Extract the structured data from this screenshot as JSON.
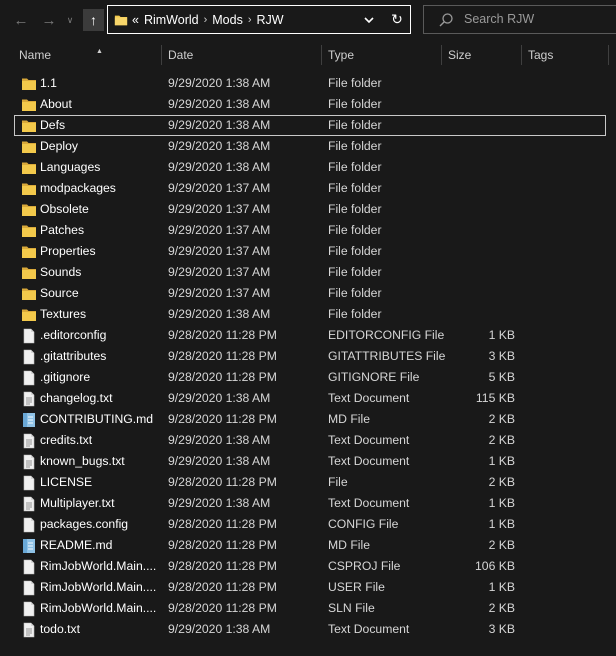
{
  "toolbar": {
    "back_glyph": "←",
    "forward_glyph": "→",
    "recent_glyph": "∨",
    "up_glyph": "↑",
    "address": {
      "overflow": "«",
      "crumbs": [
        "RimWorld",
        "Mods",
        "RJW"
      ],
      "separator": "›",
      "dropdown_glyph": "⌄",
      "refresh_glyph": "↻"
    },
    "search_placeholder": "Search RJW"
  },
  "columns": [
    "Name",
    "Date",
    "Type",
    "Size",
    "Tags"
  ],
  "colors": {
    "background": "#191919",
    "folder": "#f3c94b",
    "folder_dark": "#d9a93a",
    "file": "#f0f0f0",
    "md_file": "#8fc2e6",
    "selected_border": "#c8c8c8"
  },
  "files": [
    {
      "name": "1.1",
      "date": "9/29/2020 1:38 AM",
      "type": "File folder",
      "size": "",
      "icon": "folder-icon"
    },
    {
      "name": "About",
      "date": "9/29/2020 1:38 AM",
      "type": "File folder",
      "size": "",
      "icon": "folder-icon"
    },
    {
      "name": "Defs",
      "date": "9/29/2020 1:38 AM",
      "type": "File folder",
      "size": "",
      "icon": "folder-icon",
      "selected": true
    },
    {
      "name": "Deploy",
      "date": "9/29/2020 1:38 AM",
      "type": "File folder",
      "size": "",
      "icon": "folder-icon"
    },
    {
      "name": "Languages",
      "date": "9/29/2020 1:38 AM",
      "type": "File folder",
      "size": "",
      "icon": "folder-icon"
    },
    {
      "name": "modpackages",
      "date": "9/29/2020 1:37 AM",
      "type": "File folder",
      "size": "",
      "icon": "folder-icon"
    },
    {
      "name": "Obsolete",
      "date": "9/29/2020 1:37 AM",
      "type": "File folder",
      "size": "",
      "icon": "folder-icon"
    },
    {
      "name": "Patches",
      "date": "9/29/2020 1:37 AM",
      "type": "File folder",
      "size": "",
      "icon": "folder-icon"
    },
    {
      "name": "Properties",
      "date": "9/29/2020 1:37 AM",
      "type": "File folder",
      "size": "",
      "icon": "folder-icon"
    },
    {
      "name": "Sounds",
      "date": "9/29/2020 1:37 AM",
      "type": "File folder",
      "size": "",
      "icon": "folder-icon"
    },
    {
      "name": "Source",
      "date": "9/29/2020 1:37 AM",
      "type": "File folder",
      "size": "",
      "icon": "folder-icon"
    },
    {
      "name": "Textures",
      "date": "9/29/2020 1:38 AM",
      "type": "File folder",
      "size": "",
      "icon": "folder-icon"
    },
    {
      "name": ".editorconfig",
      "date": "9/28/2020 11:28 PM",
      "type": "EDITORCONFIG File",
      "size": "1 KB",
      "icon": "file-icon"
    },
    {
      "name": ".gitattributes",
      "date": "9/28/2020 11:28 PM",
      "type": "GITATTRIBUTES File",
      "size": "3 KB",
      "icon": "file-icon"
    },
    {
      "name": ".gitignore",
      "date": "9/28/2020 11:28 PM",
      "type": "GITIGNORE File",
      "size": "5 KB",
      "icon": "file-icon"
    },
    {
      "name": "changelog.txt",
      "date": "9/29/2020 1:38 AM",
      "type": "Text Document",
      "size": "115 KB",
      "icon": "text-file-icon"
    },
    {
      "name": "CONTRIBUTING.md",
      "date": "9/28/2020 11:28 PM",
      "type": "MD File",
      "size": "2 KB",
      "icon": "markdown-file-icon"
    },
    {
      "name": "credits.txt",
      "date": "9/29/2020 1:38 AM",
      "type": "Text Document",
      "size": "2 KB",
      "icon": "text-file-icon"
    },
    {
      "name": "known_bugs.txt",
      "date": "9/29/2020 1:38 AM",
      "type": "Text Document",
      "size": "1 KB",
      "icon": "text-file-icon"
    },
    {
      "name": "LICENSE",
      "date": "9/28/2020 11:28 PM",
      "type": "File",
      "size": "2 KB",
      "icon": "file-icon"
    },
    {
      "name": "Multiplayer.txt",
      "date": "9/29/2020 1:38 AM",
      "type": "Text Document",
      "size": "1 KB",
      "icon": "text-file-icon"
    },
    {
      "name": "packages.config",
      "date": "9/28/2020 11:28 PM",
      "type": "CONFIG File",
      "size": "1 KB",
      "icon": "file-icon"
    },
    {
      "name": "README.md",
      "date": "9/28/2020 11:28 PM",
      "type": "MD File",
      "size": "2 KB",
      "icon": "markdown-file-icon"
    },
    {
      "name": "RimJobWorld.Main....",
      "date": "9/28/2020 11:28 PM",
      "type": "CSPROJ File",
      "size": "106 KB",
      "icon": "file-icon"
    },
    {
      "name": "RimJobWorld.Main....",
      "date": "9/28/2020 11:28 PM",
      "type": "USER File",
      "size": "1 KB",
      "icon": "file-icon"
    },
    {
      "name": "RimJobWorld.Main....",
      "date": "9/28/2020 11:28 PM",
      "type": "SLN File",
      "size": "2 KB",
      "icon": "file-icon"
    },
    {
      "name": "todo.txt",
      "date": "9/29/2020 1:38 AM",
      "type": "Text Document",
      "size": "3 KB",
      "icon": "text-file-icon"
    }
  ]
}
